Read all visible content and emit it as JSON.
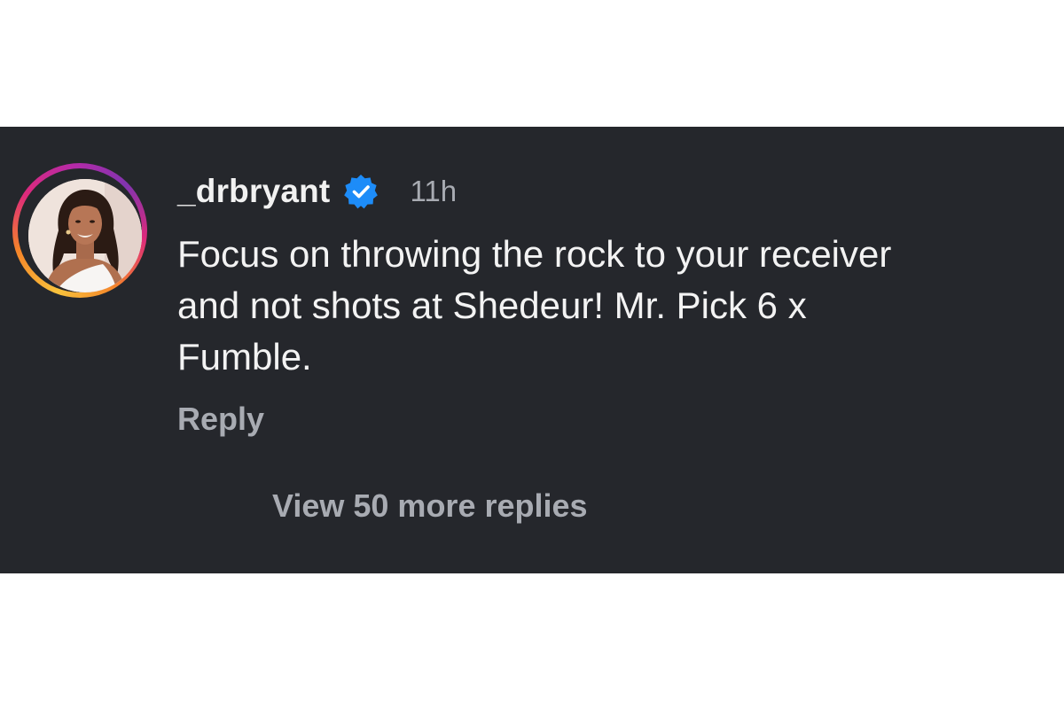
{
  "comment": {
    "username": "_drbryant",
    "verified_icon": "verified-badge-icon",
    "timestamp": "11h",
    "text": "Focus on throwing the rock to your receiver\nand not shots at Shedeur! Mr. Pick 6 x\nFumble.",
    "reply_label": "Reply",
    "view_replies_label": "View 50 more replies"
  },
  "colors": {
    "panel_background": "#25272c",
    "primary_text": "#f3f3f3",
    "secondary_text": "#a8abb2",
    "verified_blue": "#1d8cf8"
  }
}
